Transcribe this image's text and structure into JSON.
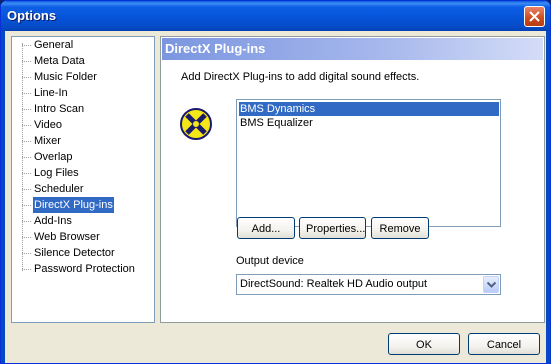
{
  "window": {
    "title": "Options"
  },
  "tree": {
    "items": [
      {
        "label": "General"
      },
      {
        "label": "Meta Data"
      },
      {
        "label": "Music Folder"
      },
      {
        "label": "Line-In"
      },
      {
        "label": "Intro Scan"
      },
      {
        "label": "Video"
      },
      {
        "label": "Mixer"
      },
      {
        "label": "Overlap"
      },
      {
        "label": "Log Files"
      },
      {
        "label": "Scheduler"
      },
      {
        "label": "DirectX Plug-ins",
        "selected": true
      },
      {
        "label": "Add-Ins"
      },
      {
        "label": "Web Browser"
      },
      {
        "label": "Silence Detector"
      },
      {
        "label": "Password Protection"
      }
    ]
  },
  "panel": {
    "title": "DirectX Plug-ins",
    "description": "Add DirectX Plug-ins to add digital sound effects.",
    "plugins": [
      {
        "label": "BMS Dynamics",
        "selected": true
      },
      {
        "label": "BMS Equalizer"
      }
    ],
    "buttons": {
      "add": "Add...",
      "properties": "Properties...",
      "remove": "Remove"
    },
    "output_device_label": "Output device",
    "output_device_value": "DirectSound: Realtek HD Audio output"
  },
  "footer": {
    "ok": "OK",
    "cancel": "Cancel"
  },
  "colors": {
    "selection": "#316ac5",
    "titlebar": "#0653d6",
    "dialog_bg": "#ece9d8"
  }
}
